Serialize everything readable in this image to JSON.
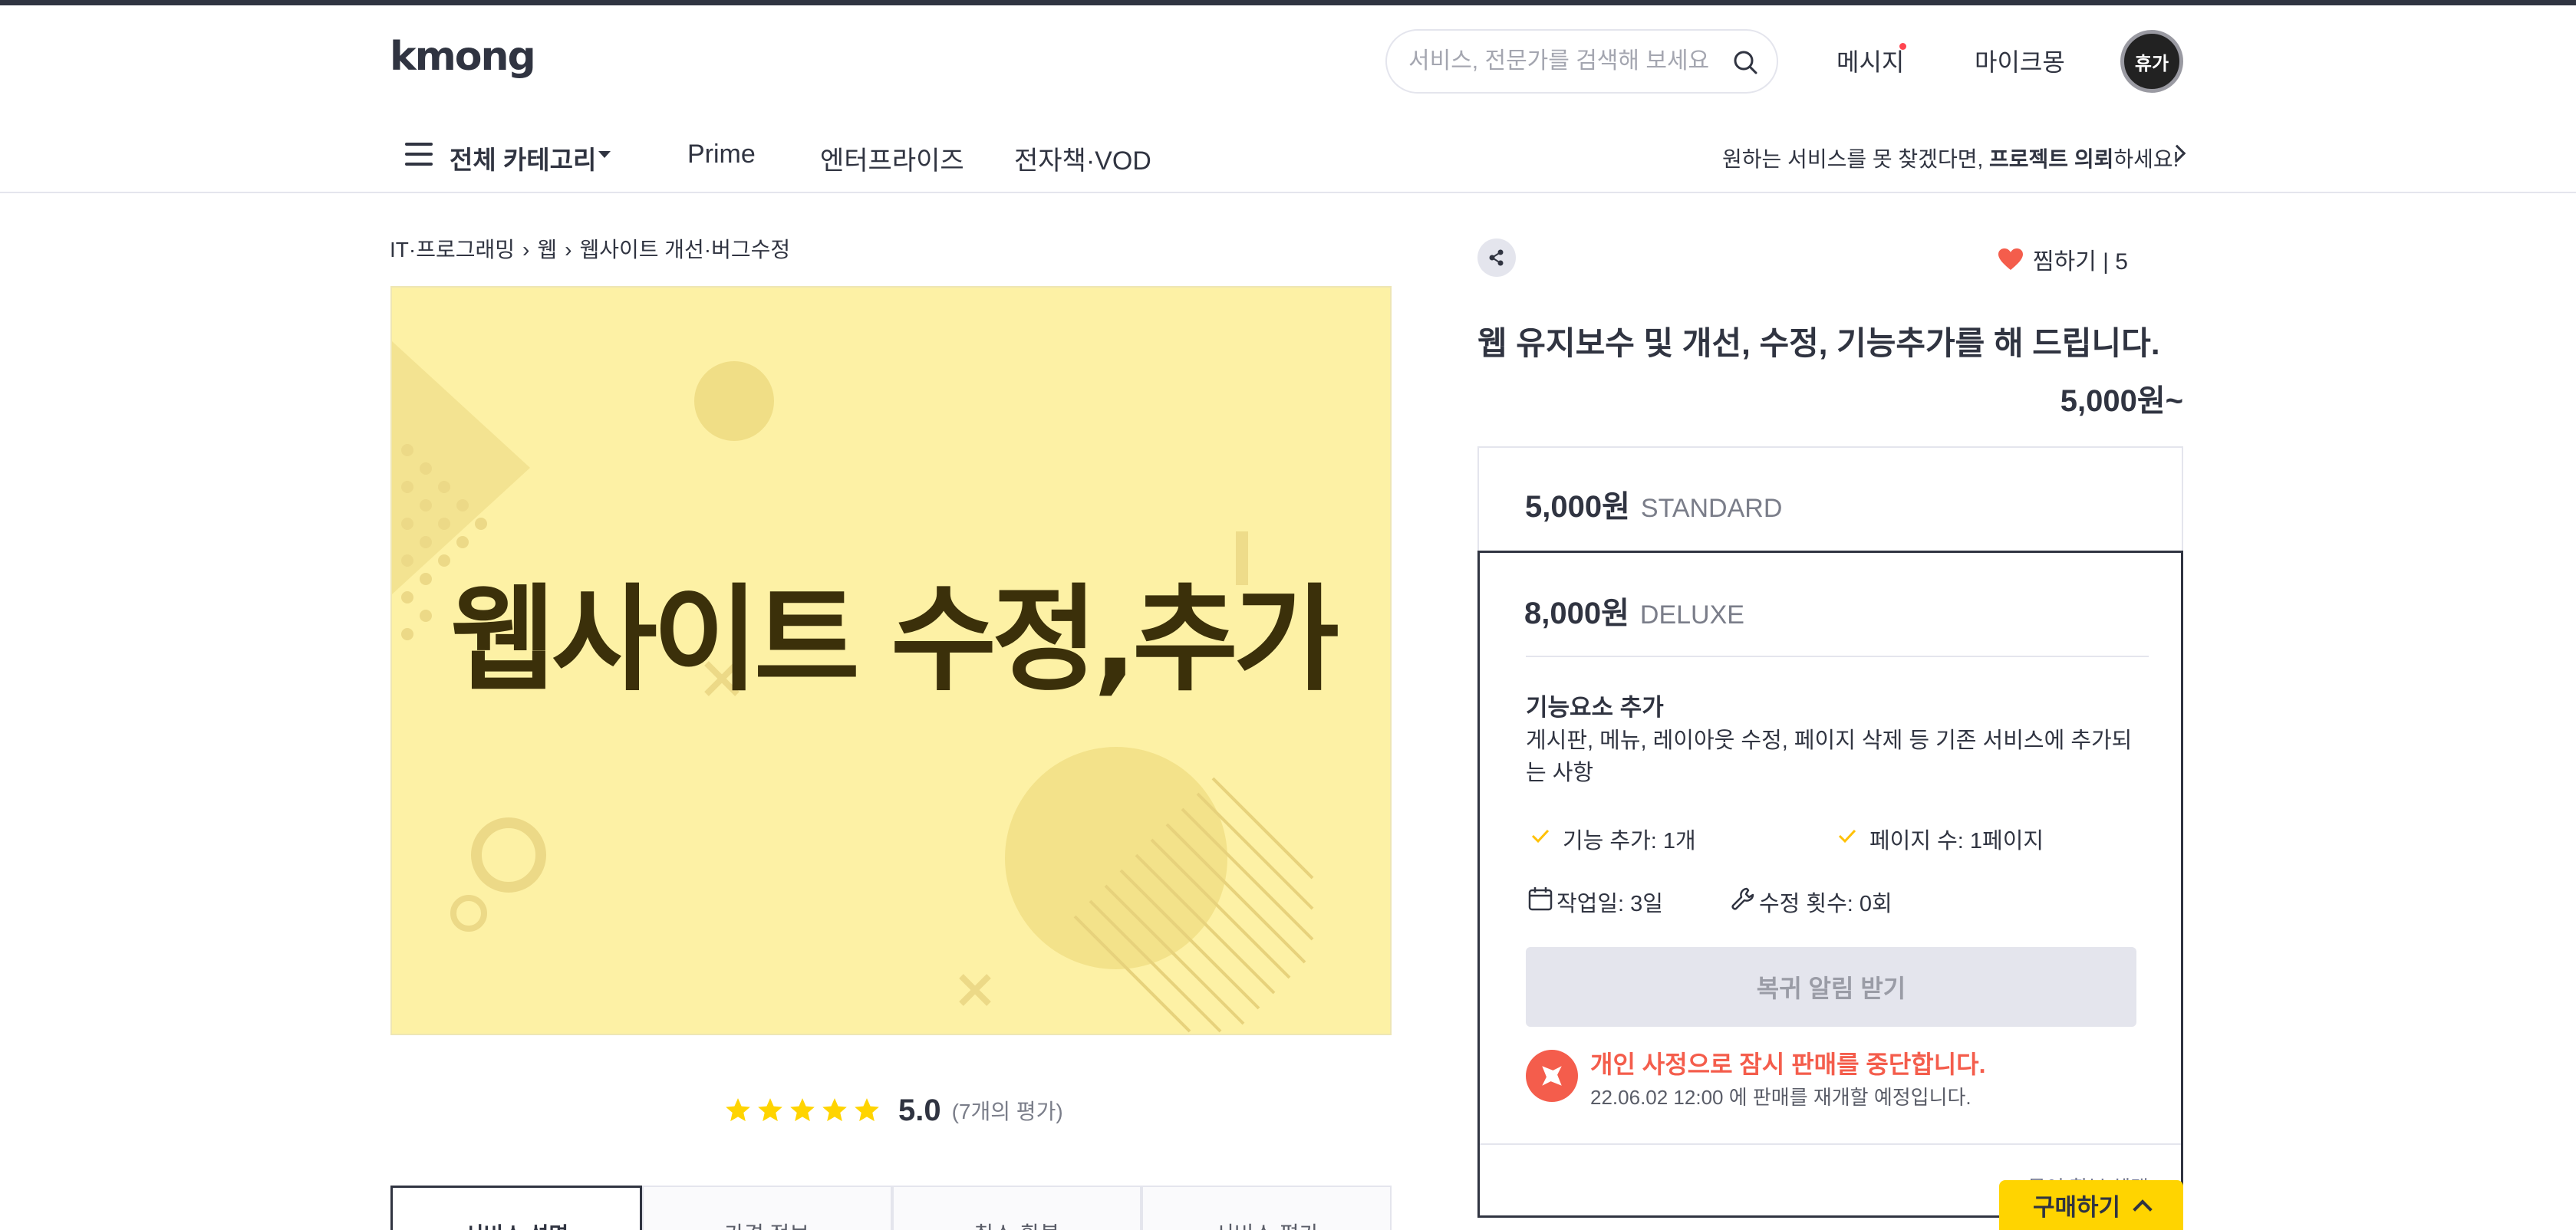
{
  "header": {
    "logo": "kmong",
    "search_placeholder": "서비스, 전문가를 검색해 보세요",
    "messages_label": "메시지",
    "mykmong_label": "마이크몽",
    "avatar_text": "휴가"
  },
  "nav": {
    "all_categories": "전체 카테고리",
    "items": [
      "Prime",
      "엔터프라이즈",
      "전자책·VOD"
    ],
    "request_prefix": "원하는 서비스를 못 찾겠다면, ",
    "request_bold": "프로젝트 의뢰",
    "request_suffix": "하세요!"
  },
  "breadcrumb": [
    "IT·프로그래밍",
    "웹",
    "웹사이트 개선·버그수정"
  ],
  "hero": {
    "text": "웹사이트 수정,추가",
    "bg_color": "#fdf1a5"
  },
  "rating": {
    "score": "5.0",
    "count": "(7개의 평가)",
    "stars": 5
  },
  "tabs": [
    "서비스 설명",
    "가격 정보",
    "취소·환불",
    "서비스 평가"
  ],
  "product": {
    "wish_label": "찜하기 | 5",
    "title": "웹 유지보수 및 개선, 수정, 기능추가를 해 드립니다.",
    "price_from": "5,000원~"
  },
  "packages": {
    "standard": {
      "price": "5,000원",
      "name": "STANDARD"
    },
    "deluxe": {
      "price": "8,000원",
      "name": "DELUXE",
      "feature_title": "기능요소 추가",
      "feature_desc": "게시판, 메뉴, 레이아웃 수정, 페이지 삭제 등 기존 서비스에 추가되는 사항",
      "spec_features": "기능 추가: 1개",
      "spec_pages": "페이지 수: 1페이지",
      "spec_days": "작업일: 3일",
      "spec_revisions": "수정 횟수: 0회",
      "notify_button": "복귀 알림 받기",
      "pause_title": "개인 사정으로 잠시 판매를 중단합니다.",
      "pause_sub": "22.06.02 12:00 에 판매를 재개할 예정입니다.",
      "benefit_label": "묶어 할부 혜택"
    }
  },
  "buy_bar": {
    "label": "구매하기"
  },
  "colors": {
    "accent_yellow": "#ffd400",
    "alert_red": "#f45d4c",
    "text_dark": "#303441"
  }
}
